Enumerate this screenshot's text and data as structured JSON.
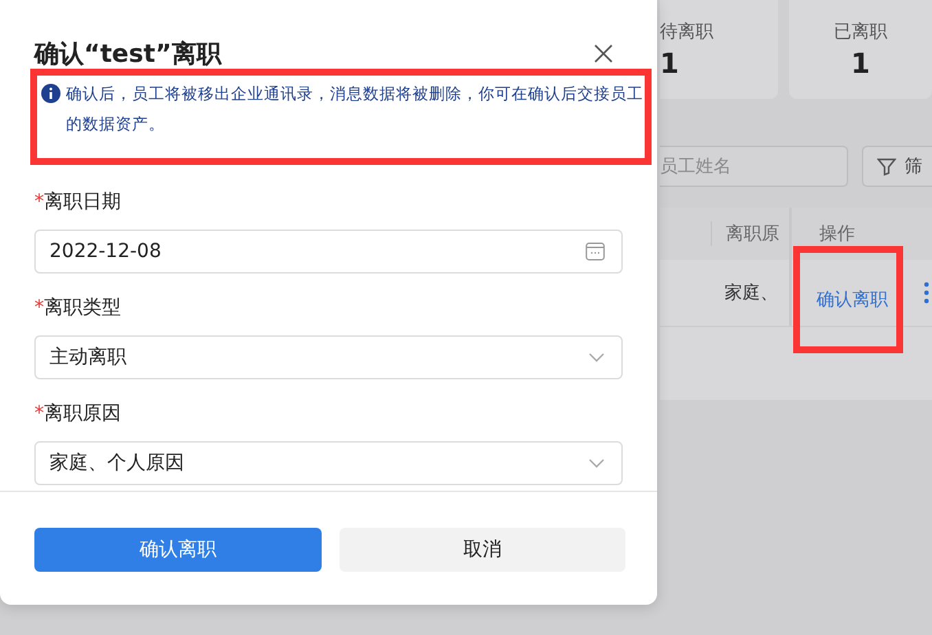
{
  "background_page": {
    "stats": [
      {
        "label": "待离职",
        "value": "1"
      },
      {
        "label": "已离职",
        "value": "1"
      }
    ],
    "search": {
      "placeholder": "员工姓名"
    },
    "filter_button": {
      "label": "筛"
    },
    "table": {
      "columns": [
        "离职原",
        "操作"
      ],
      "rows": [
        {
          "reason": "家庭、",
          "action": "确认离职",
          "action_highlighted": true
        }
      ]
    }
  },
  "dialog": {
    "title": "确认“test”离职",
    "notice": {
      "text": "确认后，员工将被移出企业通讯录，消息数据将被删除，你可在确认后交接员工的数据资产。",
      "highlighted": true
    },
    "fields": [
      {
        "kind": "date",
        "label": "离职日期",
        "required_mark": "*",
        "value": "2022-12-08"
      },
      {
        "kind": "select",
        "label": "离职类型",
        "required_mark": "*",
        "value": "主动离职"
      },
      {
        "kind": "select",
        "label": "离职原因",
        "required_mark": "*",
        "value": "家庭、个人原因"
      }
    ],
    "buttons": [
      {
        "kind": "primary",
        "label": "确认离职"
      },
      {
        "kind": "secondary",
        "label": "取消"
      }
    ]
  }
}
